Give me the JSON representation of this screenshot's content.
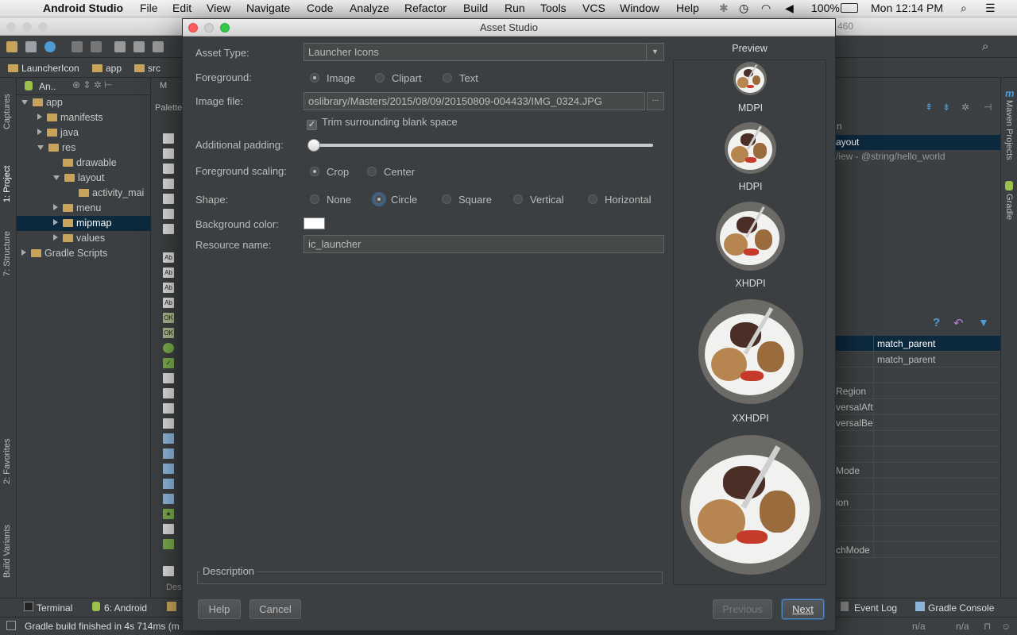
{
  "menubar": {
    "apple_glyph": "",
    "app_name": "Android Studio",
    "menus": [
      "File",
      "Edit",
      "View",
      "Navigate",
      "Code",
      "Analyze",
      "Refactor",
      "Build",
      "Run",
      "Tools",
      "VCS",
      "Window",
      "Help"
    ],
    "battery": "100%",
    "clock": "Mon 12:14 PM"
  },
  "ide": {
    "breadcrumb": [
      "LauncherIcon",
      "app",
      "src"
    ],
    "project_view": "An..",
    "tree": [
      {
        "label": "app",
        "level": 0,
        "arrow": "open"
      },
      {
        "label": "manifests",
        "level": 1,
        "arrow": "closed"
      },
      {
        "label": "java",
        "level": 1,
        "arrow": "closed"
      },
      {
        "label": "res",
        "level": 1,
        "arrow": "open"
      },
      {
        "label": "drawable",
        "level": 2,
        "arrow": ""
      },
      {
        "label": "layout",
        "level": 2,
        "arrow": "open"
      },
      {
        "label": "activity_mai",
        "level": 3,
        "arrow": ""
      },
      {
        "label": "menu",
        "level": 2,
        "arrow": "closed"
      },
      {
        "label": "mipmap",
        "level": 2,
        "arrow": "closed",
        "selected": true
      },
      {
        "label": "values",
        "level": 2,
        "arrow": "closed"
      },
      {
        "label": "Gradle Scripts",
        "level": 0,
        "arrow": "closed"
      }
    ],
    "left_tabs": [
      "Captures",
      "1: Project",
      "7: Structure",
      "2: Favorites",
      "Build Variants"
    ],
    "right_tabs": [
      "Maven Projects",
      "Gradle"
    ],
    "palette_title": "Palette",
    "editor_tab": "M",
    "component_tree_partial": [
      "n",
      "ayout",
      "/iew - @string/hello_world"
    ],
    "properties": [
      {
        "name": "",
        "value": "match_parent",
        "selected": true
      },
      {
        "name": "",
        "value": "match_parent"
      },
      {
        "name": "",
        "value": ""
      },
      {
        "name": "Region",
        "value": ""
      },
      {
        "name": "versalAft",
        "value": ""
      },
      {
        "name": "versalBef",
        "value": ""
      },
      {
        "name": "",
        "value": ""
      },
      {
        "name": "",
        "value": ""
      },
      {
        "name": "Mode",
        "value": ""
      },
      {
        "name": "",
        "value": "",
        "checkbox": true
      },
      {
        "name": "ion",
        "value": ""
      },
      {
        "name": "",
        "value": ""
      },
      {
        "name": "",
        "value": "",
        "checkbox": true
      },
      {
        "name": "chMode",
        "value": "",
        "checkbox": true
      }
    ],
    "bottom_tabs": [
      "Terminal",
      "6: Android"
    ],
    "bottom_right_tabs": [
      "Event Log",
      "Gradle Console"
    ],
    "status": "Gradle build finished in 4s 714ms (m",
    "status_right": [
      "n/a",
      "n/a"
    ],
    "desc_tab": "Des",
    "title_fragment": "460"
  },
  "dialog": {
    "title": "Asset Studio",
    "asset_type_label": "Asset Type:",
    "asset_type_value": "Launcher Icons",
    "foreground_label": "Foreground:",
    "foreground_options": [
      {
        "label": "Image",
        "selected": true
      },
      {
        "label": "Clipart"
      },
      {
        "label": "Text"
      }
    ],
    "image_file_label": "Image file:",
    "image_file_value": "oslibrary/Masters/2015/08/09/20150809-004433/IMG_0324.JPG",
    "browse_label": "...",
    "trim_label": "Trim surrounding blank space",
    "trim_checked": true,
    "padding_label": "Additional padding:",
    "padding_value": 0,
    "scaling_label": "Foreground scaling:",
    "scaling_options": [
      {
        "label": "Crop",
        "selected": true
      },
      {
        "label": "Center"
      }
    ],
    "shape_label": "Shape:",
    "shape_options": [
      {
        "label": "None"
      },
      {
        "label": "Circle",
        "selected": true
      },
      {
        "label": "Square"
      },
      {
        "label": "Vertical"
      },
      {
        "label": "Horizontal"
      }
    ],
    "bg_color_label": "Background color:",
    "bg_color": "#ffffff",
    "resource_label": "Resource name:",
    "resource_value": "ic_launcher",
    "description_label": "Description",
    "preview_title": "Preview",
    "densities": [
      "MDPI",
      "HDPI",
      "XHDPI",
      "XXHDPI"
    ],
    "buttons": {
      "help": "Help",
      "cancel": "Cancel",
      "previous": "Previous",
      "next": "Next"
    }
  }
}
